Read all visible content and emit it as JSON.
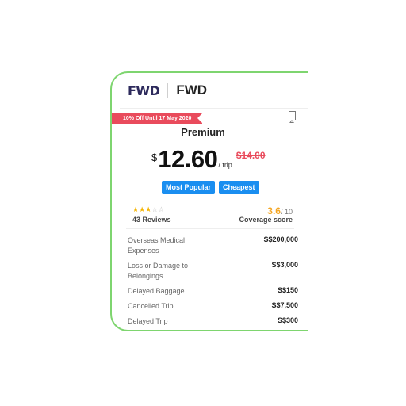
{
  "card": {
    "logo_text": "FWD",
    "insurer_name": "FWD",
    "promo": "10% Off Until 17 May 2020",
    "plan_name": "Premium",
    "currency_symbol": "$",
    "price": "12.60",
    "per": "/ trip",
    "old_price": "$14.00",
    "tags": [
      "Most Popular",
      "Cheapest"
    ],
    "rating": {
      "stars_filled": 3,
      "stars_total": 5,
      "reviews": "43 Reviews"
    },
    "coverage": {
      "score": "3.6",
      "max": "/ 10",
      "label": "Coverage score"
    },
    "benefits": [
      {
        "label": "Overseas Medical Expenses",
        "value": "S$200,000"
      },
      {
        "label": "Loss or Damage to Belongings",
        "value": "S$3,000"
      },
      {
        "label": "Delayed Baggage",
        "value": "S$150"
      },
      {
        "label": "Cancelled Trip",
        "value": "S$7,500"
      },
      {
        "label": "Delayed Trip",
        "value": "S$300"
      }
    ],
    "colors": {
      "border": "#7ed56f",
      "promo": "#e94b5c",
      "tag": "#1a8ef0",
      "star": "#f5b400",
      "score": "#f5a623"
    }
  }
}
